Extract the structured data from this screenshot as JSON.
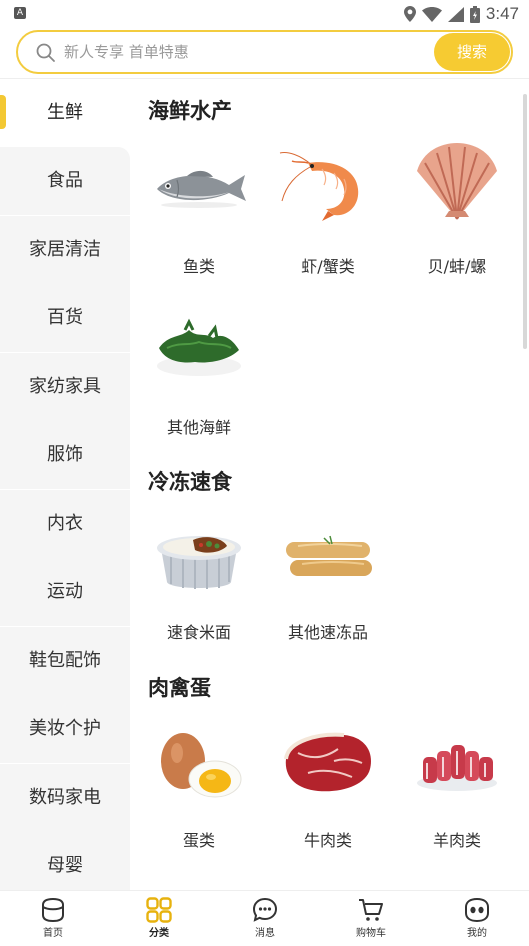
{
  "status_bar": {
    "time": "3:47",
    "left_icon_letter": "A"
  },
  "search": {
    "placeholder": "新人专享 首单特惠",
    "button_label": "搜索"
  },
  "sidebar": {
    "items": [
      {
        "label": "生鲜",
        "active": true
      },
      {
        "label": "食品"
      },
      {
        "label": "家居清洁"
      },
      {
        "label": "百货"
      },
      {
        "label": "家纺家具"
      },
      {
        "label": "服饰"
      },
      {
        "label": "内衣"
      },
      {
        "label": "运动"
      },
      {
        "label": "鞋包配饰"
      },
      {
        "label": "美妆个护"
      },
      {
        "label": "数码家电"
      },
      {
        "label": "母婴"
      }
    ]
  },
  "sections": [
    {
      "title": "海鲜水产",
      "items": [
        {
          "label": "鱼类",
          "icon": "fish-icon"
        },
        {
          "label": "虾/蟹类",
          "icon": "shrimp-icon"
        },
        {
          "label": "贝/蚌/螺",
          "icon": "scallop-icon"
        },
        {
          "label": "其他海鲜",
          "icon": "seaweed-icon"
        }
      ]
    },
    {
      "title": "冷冻速食",
      "items": [
        {
          "label": "速食米面",
          "icon": "rice-pot-icon"
        },
        {
          "label": "其他速冻品",
          "icon": "sausage-icon"
        }
      ]
    },
    {
      "title": "肉禽蛋",
      "items": [
        {
          "label": "蛋类",
          "icon": "egg-icon"
        },
        {
          "label": "牛肉类",
          "icon": "beef-icon"
        },
        {
          "label": "羊肉类",
          "icon": "mutton-icon"
        }
      ]
    }
  ],
  "bottom_nav": {
    "items": [
      {
        "label": "首页",
        "icon": "home-face-icon"
      },
      {
        "label": "分类",
        "icon": "category-grid-icon",
        "active": true
      },
      {
        "label": "消息",
        "icon": "message-bubble-icon"
      },
      {
        "label": "购物车",
        "icon": "cart-icon"
      },
      {
        "label": "我的",
        "icon": "profile-face-icon"
      }
    ]
  },
  "colors": {
    "accent": "#f6cb32",
    "sidebar_bg": "#f5f5f5",
    "text": "#333333"
  }
}
